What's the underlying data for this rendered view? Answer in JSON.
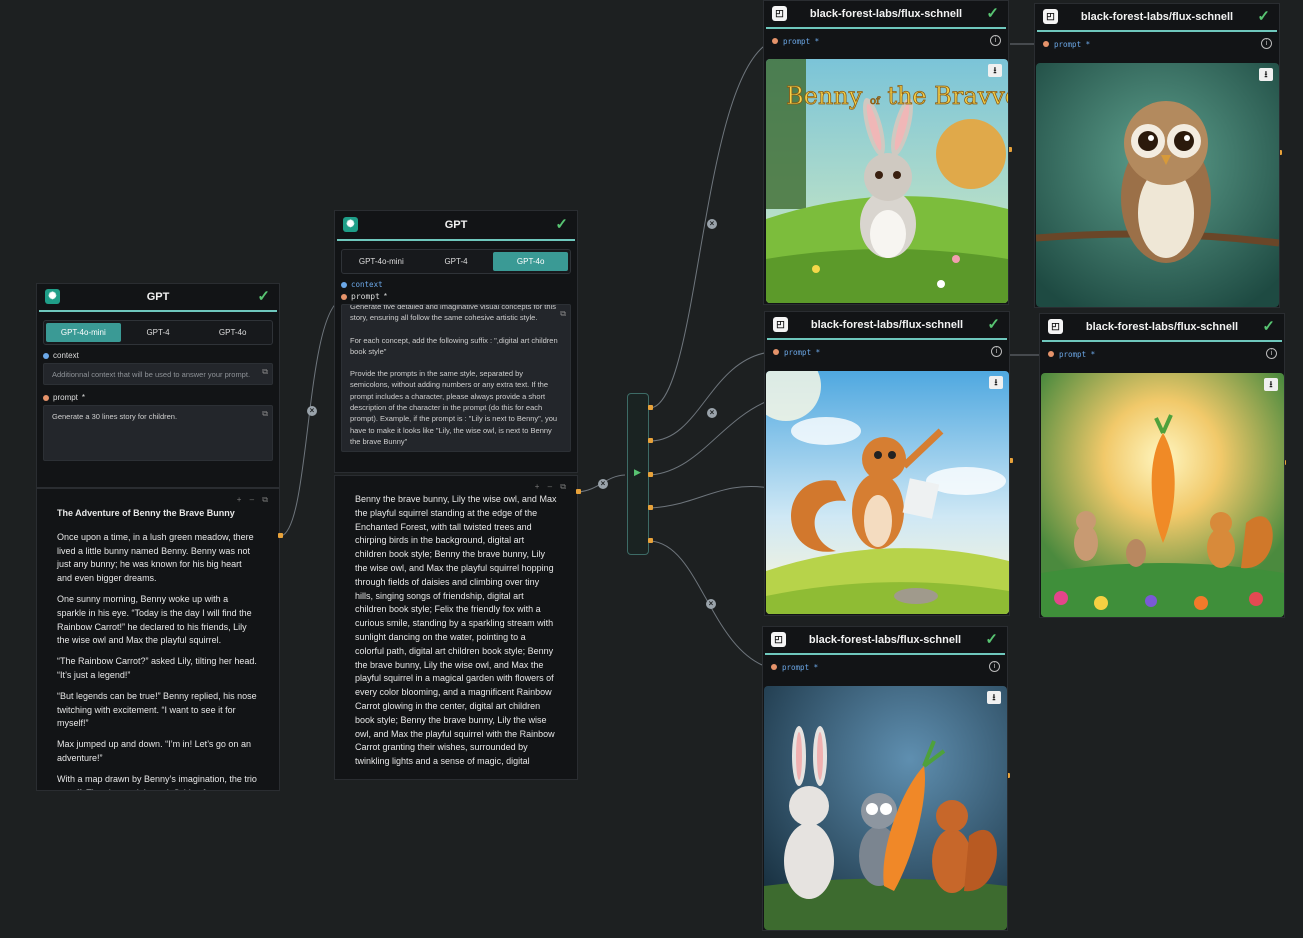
{
  "gpt1": {
    "title": "GPT",
    "tabs": [
      "GPT-4o-mini",
      "GPT-4",
      "GPT-4o"
    ],
    "active_tab": 0,
    "context_label": "context",
    "context_placeholder": "Additionnal context that will be used to answer your prompt.",
    "prompt_label": "prompt",
    "prompt_required": "*",
    "prompt_value": "Generate a 30 lines story for children.",
    "output_title": "The Adventure of Benny the Brave Bunny",
    "output_paragraphs": [
      "Once upon a time, in a lush green meadow, there lived a little bunny named Benny. Benny was not just any bunny; he was known for his big heart and even bigger dreams.",
      "One sunny morning, Benny woke up with a sparkle in his eye. “Today is the day I will find the Rainbow Carrot!” he declared to his friends, Lily the wise owl and Max the playful squirrel.",
      "“The Rainbow Carrot?” asked Lily, tilting her head. “It’s just a legend!”",
      "“But legends can be true!” Benny replied, his nose twitching with excitement. “I want to see it for myself!”",
      "Max jumped up and down. “I’m in! Let’s go on an adventure!”",
      "With a map drawn by Benny’s imagination, the trio set off. They hopped through fields of"
    ],
    "output_tools": "+ – ⧉"
  },
  "gpt2": {
    "title": "GPT",
    "tabs": [
      "GPT-4o-mini",
      "GPT-4",
      "GPT-4o"
    ],
    "active_tab": 2,
    "context_label": "context",
    "prompt_label": "prompt",
    "prompt_required": "*",
    "prompt_paragraphs": [
      "Generate five detailed and imaginative visual concepts for this story, ensuring all follow the same cohesive artistic style.",
      "For each concept, add the following suffix : \",digital art children book style\"",
      "Provide the prompts in the same style, separated by semicolons, without adding numbers or any extra text. If the prompt includes a character, please always provide a short description of the character in the prompt (do this for each prompt).  Example, if the prompt is : \"Lily is next to Benny\", you have to make it looks like \"Lily, the wise owl, is next to Benny the brave Bunny\""
    ],
    "output_text": "Benny the brave bunny, Lily the wise owl, and Max the playful squirrel standing at the edge of the Enchanted Forest, with tall twisted trees and chirping birds in the background, digital art children book style; Benny the brave bunny, Lily the wise owl, and Max the playful squirrel hopping through fields of daisies and climbing over tiny hills, singing songs of friendship, digital art children book style; Felix the friendly fox with a curious smile, standing by a sparkling stream with sunlight dancing on the water, pointing to a colorful path, digital art children book style; Benny the brave bunny, Lily the wise owl, and Max the playful squirrel in a magical garden with flowers of every color blooming, and a magnificent Rainbow Carrot glowing in the center, digital art children book style; Benny the brave bunny, Lily the wise owl, and Max the playful squirrel with the Rainbow Carrot granting their wishes, surrounded by twinkling lights and a sense of magic, digital",
    "output_tools": "+ – ⧉"
  },
  "flux_nodes": [
    {
      "title": "black-forest-labs/flux-schnell",
      "prompt_label": "prompt",
      "required": "*",
      "image": "bunny-meadow",
      "image_text": [
        "Benny",
        "of",
        "the",
        "Bravve"
      ]
    },
    {
      "title": "black-forest-labs/flux-schnell",
      "prompt_label": "prompt",
      "required": "*",
      "image": "owl-branch"
    },
    {
      "title": "black-forest-labs/flux-schnell",
      "prompt_label": "prompt",
      "required": "*",
      "image": "squirrel-hill"
    },
    {
      "title": "black-forest-labs/flux-schnell",
      "prompt_label": "prompt",
      "required": "*",
      "image": "garden-carrot"
    },
    {
      "title": "black-forest-labs/flux-schnell",
      "prompt_label": "prompt",
      "required": "*",
      "image": "trio-carrot"
    }
  ],
  "icons": {
    "gpt": "openai-icon",
    "flux": "replicate-icon",
    "check": "checkmark-icon",
    "download": "download-icon",
    "info": "info-icon",
    "external": "external-link-icon"
  },
  "colors": {
    "accent": "#3a9a95",
    "success": "#58c472",
    "port": "#e8a23a",
    "context_dot": "#6ca8e8",
    "prompt_dot": "#e5936a"
  }
}
